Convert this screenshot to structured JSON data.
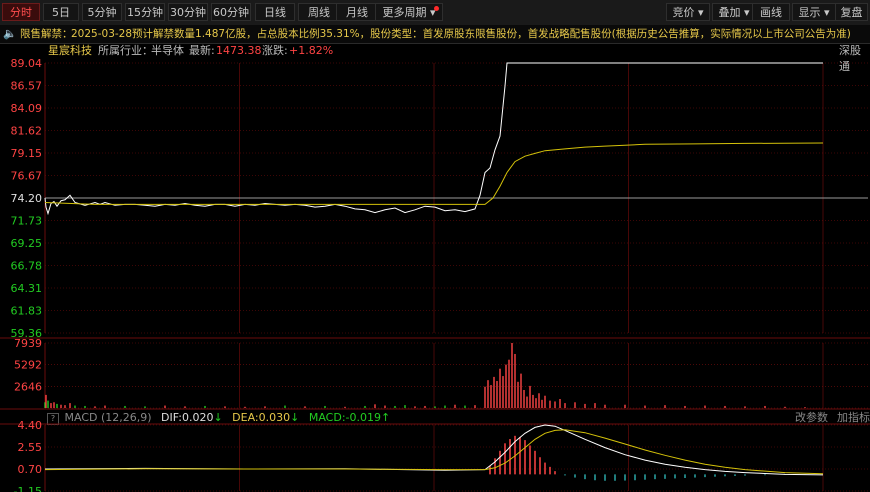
{
  "toolbar": {
    "tabs": [
      {
        "label": "分时",
        "active": true
      },
      {
        "label": "5日"
      },
      {
        "label": "5分钟"
      },
      {
        "label": "15分钟"
      },
      {
        "label": "30分钟"
      },
      {
        "label": "60分钟"
      },
      {
        "label": "日线"
      },
      {
        "label": "周线"
      },
      {
        "label": "月线"
      },
      {
        "label": "更多周期 ▾"
      }
    ],
    "right": [
      "竞价 ▾",
      "叠加 ▾",
      "画线",
      "显示 ▾",
      "复盘"
    ]
  },
  "notice": {
    "label": "限售解禁：",
    "text": "2025-03-28预计解禁数量1.487亿股，占总股本比例35.31%，股份类型：首发原股东限售股份，首发战略配售股份(根据历史公告推算，实际情况以上市公司公告为准)"
  },
  "info": {
    "name": "星宸科技",
    "industry_label": "所属行业：",
    "industry": "半导体",
    "latest_label": "最新:",
    "latest": "1473.38",
    "change_label": "涨跌:",
    "change": "+1.82%",
    "exchange": "深股通"
  },
  "colors": {
    "up": "#ff4444",
    "down": "#22cc22",
    "ref": "#e0e0e0",
    "avg": "#d4c20a",
    "price": "#ffffff",
    "grid": "#7a0d0d",
    "macd_neg": "#2aa7a7"
  },
  "macd": {
    "help": "?",
    "label": "MACD (12,26,9)",
    "dif_label": "DIF:",
    "dif": "0.020",
    "dea_label": "DEA:",
    "dea": "0.030",
    "macd_label": "MACD:",
    "macd": "-0.019",
    "btn_params": "改参数",
    "btn_add": "加指标"
  },
  "chart_data": [
    {
      "type": "line",
      "name": "price",
      "y_ticks": [
        "89.04",
        "86.57",
        "84.09",
        "81.62",
        "79.15",
        "76.67",
        "74.20",
        "71.73",
        "69.25",
        "66.78",
        "64.31",
        "61.83",
        "59.36"
      ],
      "ylim": [
        59.36,
        89.04
      ],
      "ref_price": 74.2,
      "series": [
        {
          "color": "price",
          "x": [
            0,
            1,
            3,
            6,
            9,
            12,
            16,
            20,
            25,
            30,
            40,
            50,
            55,
            60,
            70,
            80,
            90,
            100,
            110,
            120,
            130,
            140,
            150,
            160,
            170,
            180,
            190,
            200,
            210,
            220,
            230,
            240,
            250,
            260,
            270,
            280,
            290,
            300,
            310,
            320,
            330,
            340,
            350,
            360,
            370,
            380,
            390,
            400,
            410,
            420,
            430,
            435,
            440,
            445,
            450,
            455,
            460,
            462,
            463,
            468,
            475,
            500,
            778
          ],
          "values": [
            74.2,
            73.2,
            72.5,
            73.6,
            73.8,
            73.3,
            73.9,
            74.0,
            74.5,
            73.7,
            73.4,
            73.7,
            73.5,
            73.7,
            73.4,
            73.5,
            73.5,
            73.4,
            73.3,
            73.5,
            73.4,
            73.6,
            73.4,
            73.3,
            73.5,
            73.5,
            73.3,
            73.5,
            73.4,
            73.6,
            73.5,
            73.4,
            73.5,
            73.4,
            73.2,
            73.3,
            73.5,
            73.3,
            73.0,
            72.9,
            72.6,
            72.9,
            73.1,
            72.6,
            72.9,
            73.3,
            73.2,
            72.8,
            72.9,
            72.7,
            73.0,
            74.5,
            77.0,
            77.5,
            79.5,
            81.0,
            86.5,
            89.04,
            89.04,
            89.04,
            89.04,
            89.04,
            89.04
          ]
        },
        {
          "color": "avg",
          "x": [
            0,
            50,
            100,
            200,
            300,
            440,
            448,
            455,
            462,
            470,
            480,
            490,
            500,
            520,
            540,
            560,
            580,
            600,
            650,
            700,
            778
          ],
          "values": [
            73.7,
            73.5,
            73.5,
            73.5,
            73.5,
            73.5,
            74.2,
            75.5,
            77.0,
            78.2,
            78.8,
            79.1,
            79.4,
            79.6,
            79.8,
            79.9,
            80.0,
            80.1,
            80.15,
            80.2,
            80.25
          ]
        }
      ]
    },
    {
      "type": "bar",
      "name": "volume",
      "y_ticks": [
        "7939",
        "5292",
        "2646"
      ],
      "ylim": [
        0,
        7939
      ],
      "x": [
        0,
        1,
        3,
        6,
        9,
        12,
        16,
        20,
        25,
        30,
        40,
        50,
        60,
        80,
        100,
        120,
        140,
        160,
        180,
        200,
        220,
        240,
        260,
        280,
        300,
        320,
        330,
        340,
        350,
        360,
        370,
        380,
        390,
        400,
        410,
        420,
        430,
        440,
        443,
        446,
        449,
        452,
        455,
        458,
        461,
        464,
        467,
        470,
        473,
        476,
        479,
        482,
        485,
        488,
        491,
        494,
        497,
        500,
        505,
        510,
        515,
        520,
        530,
        540,
        550,
        560,
        580,
        600,
        620,
        640,
        660,
        680,
        700,
        720,
        740,
        760
      ],
      "values": [
        700,
        1600,
        900,
        600,
        700,
        500,
        400,
        350,
        600,
        300,
        250,
        200,
        300,
        250,
        200,
        300,
        200,
        250,
        200,
        150,
        200,
        300,
        200,
        250,
        150,
        250,
        450,
        300,
        250,
        350,
        200,
        250,
        200,
        300,
        400,
        300,
        350,
        2600,
        3400,
        2800,
        3800,
        3300,
        4800,
        3900,
        5300,
        5900,
        7939,
        6600,
        3200,
        4200,
        2200,
        1400,
        2700,
        1600,
        1200,
        1800,
        1000,
        1500,
        900,
        800,
        1100,
        600,
        700,
        500,
        600,
        400,
        400,
        300,
        350,
        250,
        300,
        250,
        200,
        250,
        150,
        100
      ],
      "direction": [
        "down",
        "up",
        "down",
        "up",
        "up",
        "down",
        "up",
        "up",
        "up",
        "down",
        "down",
        "up",
        "up",
        "down",
        "down",
        "up",
        "up",
        "down",
        "up",
        "up",
        "up",
        "down",
        "up",
        "down",
        "up",
        "down",
        "up",
        "up",
        "down",
        "down",
        "up",
        "up",
        "down",
        "down",
        "up",
        "down",
        "up",
        "up",
        "up",
        "up",
        "up",
        "up",
        "up",
        "up",
        "up",
        "up",
        "up",
        "up",
        "up",
        "up",
        "up",
        "up",
        "up",
        "up",
        "up",
        "up",
        "up",
        "up",
        "up",
        "up",
        "up",
        "up",
        "up",
        "up",
        "up",
        "up",
        "up",
        "up",
        "up",
        "up",
        "up",
        "up",
        "up",
        "up",
        "up",
        "up"
      ]
    },
    {
      "type": "line",
      "name": "macd",
      "y_ticks": [
        "4.40",
        "2.55",
        "0.70",
        "-1.15"
      ],
      "ylim": [
        -1.15,
        4.4
      ],
      "series": [
        {
          "name": "DIF",
          "color": "#ffffff",
          "x": [
            0,
            100,
            200,
            300,
            400,
            440,
            450,
            460,
            470,
            480,
            490,
            500,
            510,
            520,
            540,
            560,
            580,
            600,
            620,
            640,
            660,
            680,
            700,
            740,
            778
          ],
          "values": [
            0.7,
            0.75,
            0.7,
            0.72,
            0.6,
            0.65,
            1.3,
            2.1,
            3.0,
            3.7,
            4.2,
            4.4,
            4.3,
            3.95,
            3.2,
            2.5,
            1.9,
            1.45,
            1.1,
            0.85,
            0.65,
            0.5,
            0.4,
            0.25,
            0.2
          ]
        },
        {
          "name": "DEA",
          "color": "#d4c20a",
          "x": [
            0,
            100,
            200,
            300,
            400,
            440,
            450,
            460,
            470,
            480,
            490,
            500,
            510,
            520,
            540,
            560,
            580,
            600,
            620,
            640,
            660,
            680,
            700,
            740,
            778
          ],
          "values": [
            0.65,
            0.72,
            0.7,
            0.7,
            0.65,
            0.65,
            0.8,
            1.2,
            1.8,
            2.5,
            3.2,
            3.7,
            3.95,
            4.0,
            3.75,
            3.3,
            2.8,
            2.3,
            1.85,
            1.45,
            1.1,
            0.85,
            0.65,
            0.4,
            0.3
          ]
        }
      ],
      "bars_x": [
        440,
        445,
        450,
        455,
        460,
        465,
        470,
        475,
        480,
        485,
        490,
        495,
        500,
        505,
        510,
        520,
        530,
        540,
        550,
        560,
        570,
        580,
        590,
        600,
        610,
        620,
        630,
        640,
        650,
        660,
        670,
        680,
        690,
        700,
        720,
        740,
        760
      ],
      "bars_values": [
        0.0,
        0.8,
        1.5,
        2.2,
        2.9,
        3.3,
        3.6,
        3.5,
        3.2,
        2.7,
        2.2,
        1.6,
        1.1,
        0.7,
        0.3,
        -0.1,
        -0.3,
        -0.45,
        -0.55,
        -0.6,
        -0.6,
        -0.58,
        -0.55,
        -0.5,
        -0.45,
        -0.42,
        -0.38,
        -0.34,
        -0.3,
        -0.26,
        -0.22,
        -0.18,
        -0.15,
        -0.12,
        -0.08,
        -0.05,
        -0.03
      ]
    }
  ]
}
